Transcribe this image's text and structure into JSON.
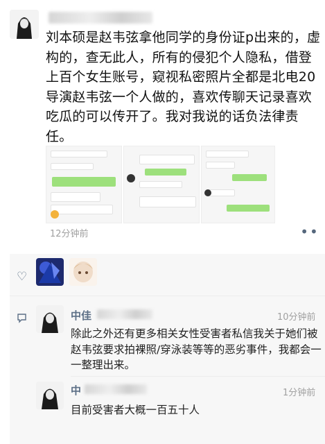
{
  "post": {
    "text": "刘本硕是赵韦弦拿他同学的身份证p出来的，虚构的，查无此人，所有的侵犯个人隐私，借登上百个女生账号，窥视私密照片全都是北电20导演赵韦弦一个人做的，喜欢传聊天记录喜欢吃瓜的可以传开了。我对我说的话负法律责任。",
    "time": "12分钟前",
    "more_label": "••"
  },
  "likes": {
    "icon": "heart-outline-icon"
  },
  "comments": [
    {
      "name": "中佳",
      "time": "10分钟前",
      "text": "除此之外还有更多相关女性受害者私信我关于她们被赵韦弦要求拍裸照/穿泳装等等的恶劣事件，我都会一一整理出来。"
    },
    {
      "name": "中",
      "time": "1分钟前",
      "text": "目前受害者大概一百五十人"
    }
  ],
  "colors": {
    "link_blue": "#5c6f86",
    "time_gray": "#a0a0a0",
    "comment_bg": "#f7f7f7",
    "chat_green": "#9de07c"
  }
}
